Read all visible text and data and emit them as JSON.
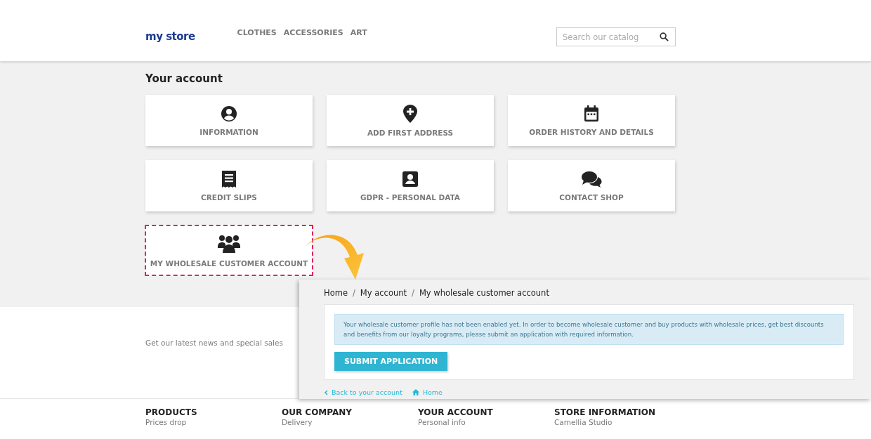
{
  "header": {
    "logo": "my store",
    "nav": [
      "CLOTHES",
      "ACCESSORIES",
      "ART"
    ],
    "search": {
      "placeholder": "Search our catalog"
    }
  },
  "account": {
    "title": "Your account",
    "tiles": [
      {
        "label": "INFORMATION",
        "kind": "user",
        "highlighted": false
      },
      {
        "label": "ADD FIRST ADDRESS",
        "kind": "pin",
        "highlighted": false
      },
      {
        "label": "ORDER HISTORY AND DETAILS",
        "kind": "calendar",
        "highlighted": false
      },
      {
        "label": "CREDIT SLIPS",
        "kind": "receipt",
        "highlighted": false
      },
      {
        "label": "GDPR - PERSONAL DATA",
        "kind": "card",
        "highlighted": false
      },
      {
        "label": "CONTACT SHOP",
        "kind": "chat",
        "highlighted": false
      },
      {
        "label": "MY WHOLESALE CUSTOMER ACCOUNT",
        "kind": "group",
        "highlighted": true
      }
    ]
  },
  "newsletter": {
    "text": "Get our latest news and special sales"
  },
  "footer": [
    {
      "heading": "PRODUCTS",
      "links": [
        "Prices drop"
      ]
    },
    {
      "heading": "OUR COMPANY",
      "links": [
        "Delivery"
      ]
    },
    {
      "heading": "YOUR ACCOUNT",
      "links": [
        "Personal info"
      ]
    },
    {
      "heading": "STORE INFORMATION",
      "links": [
        "Camellia Studio"
      ]
    }
  ],
  "wholesale_page": {
    "breadcrumb": [
      "Home",
      "My account",
      "My wholesale customer account"
    ],
    "breadcrumb_separator": "/",
    "alert": "Your wholesale customer profile has not been enabled yet. In order to become wholesale customer and buy products with wholesale prices, get best discounts and benefits from our loyalty programs, please submit an application with required information.",
    "button": "SUBMIT APPLICATION",
    "back_link": "Back to your account",
    "home_link": "Home"
  }
}
